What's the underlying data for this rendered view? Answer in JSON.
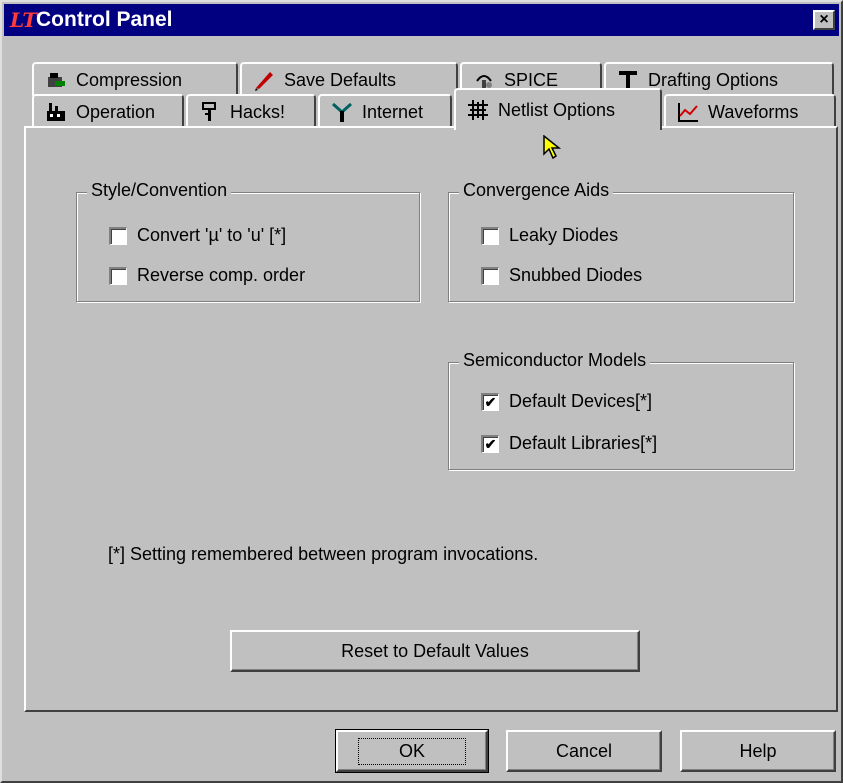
{
  "window": {
    "title": "Control Panel",
    "close_label": "×"
  },
  "tabs_row1": [
    {
      "label": "Compression",
      "icon": "compression-icon"
    },
    {
      "label": "Save Defaults",
      "icon": "pen-icon"
    },
    {
      "label": "SPICE",
      "icon": "spice-icon"
    },
    {
      "label": "Drafting Options",
      "icon": "t-square-icon"
    }
  ],
  "tabs_row2": [
    {
      "label": "Operation",
      "icon": "factory-icon"
    },
    {
      "label": "Hacks!",
      "icon": "hack-icon"
    },
    {
      "label": "Internet",
      "icon": "antenna-icon"
    },
    {
      "label": "Netlist Options",
      "icon": "grid-icon",
      "active": true
    },
    {
      "label": "Waveforms",
      "icon": "waveform-icon"
    }
  ],
  "groups": {
    "style": {
      "title": "Style/Convention",
      "items": [
        {
          "label": "Convert  'µ' to 'u' [*]",
          "checked": false
        },
        {
          "label": "Reverse comp. order",
          "checked": false
        }
      ]
    },
    "convergence": {
      "title": "Convergence Aids",
      "items": [
        {
          "label": "Leaky Diodes",
          "checked": false
        },
        {
          "label": "Snubbed Diodes",
          "checked": false
        }
      ]
    },
    "semiconductor": {
      "title": "Semiconductor Models",
      "items": [
        {
          "label": "Default Devices[*]",
          "checked": true
        },
        {
          "label": "Default Libraries[*]",
          "checked": true
        }
      ]
    }
  },
  "note": "[*] Setting remembered between program invocations.",
  "buttons": {
    "reset": "Reset to Default Values",
    "ok": "OK",
    "cancel": "Cancel",
    "help": "Help"
  },
  "colors": {
    "titlebar": "#000080",
    "face": "#c0c0c0"
  }
}
